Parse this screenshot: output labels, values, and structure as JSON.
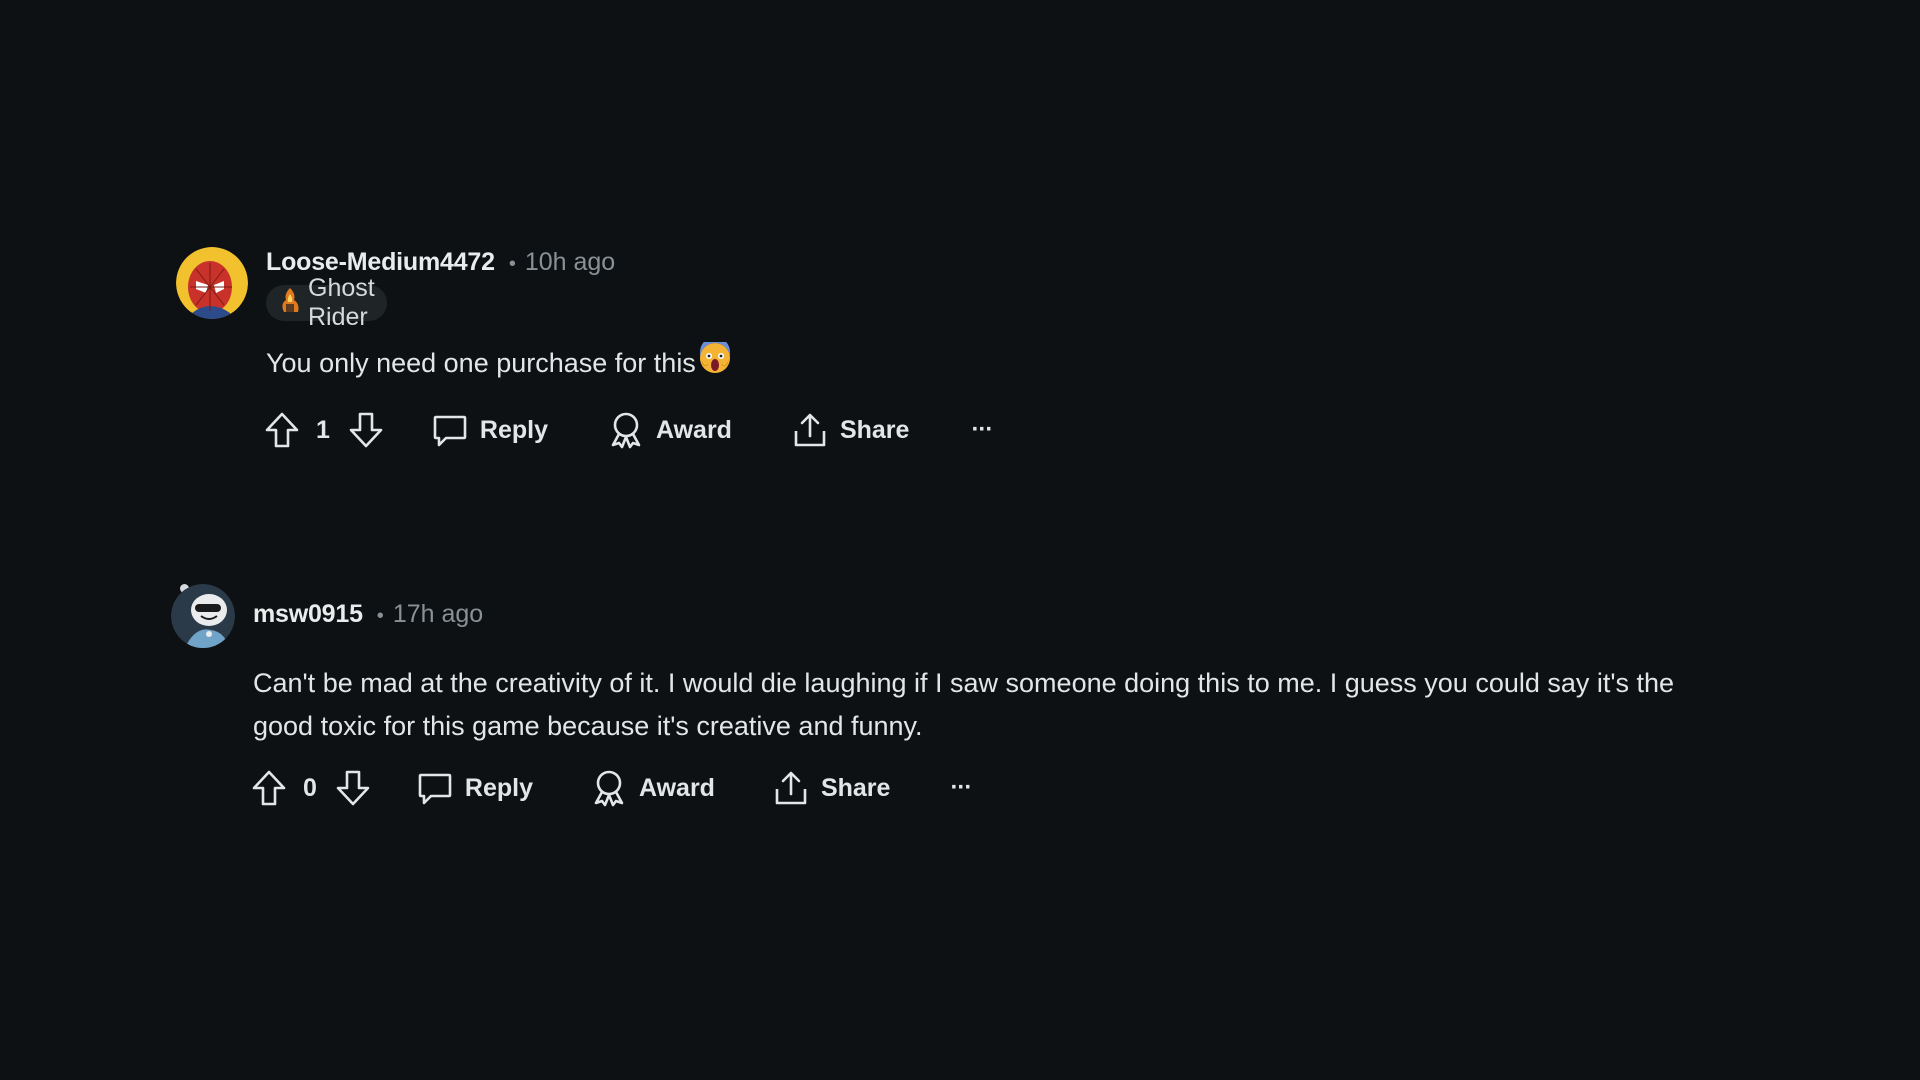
{
  "comments": [
    {
      "username": "Loose-Medium4472",
      "timestamp": "10h ago",
      "flair": "Ghost Rider",
      "body": "You only need one purchase for this",
      "emoji": "face-screaming-emoji",
      "score": "1",
      "actions": {
        "reply": "Reply",
        "award": "Award",
        "share": "Share",
        "more": "···"
      }
    },
    {
      "username": "msw0915",
      "timestamp": "17h ago",
      "body": "Can't be mad at the creativity of it. I would die laughing if I saw someone doing this to me. I guess you could say it's the good toxic for this game because it's creative and funny.",
      "score": "0",
      "actions": {
        "reply": "Reply",
        "award": "Award",
        "share": "Share",
        "more": "···"
      }
    }
  ],
  "colors": {
    "background": "#0e1113",
    "text": "#e3e6e8",
    "muted": "#8a9196",
    "flair_bg": "#1f2427"
  }
}
